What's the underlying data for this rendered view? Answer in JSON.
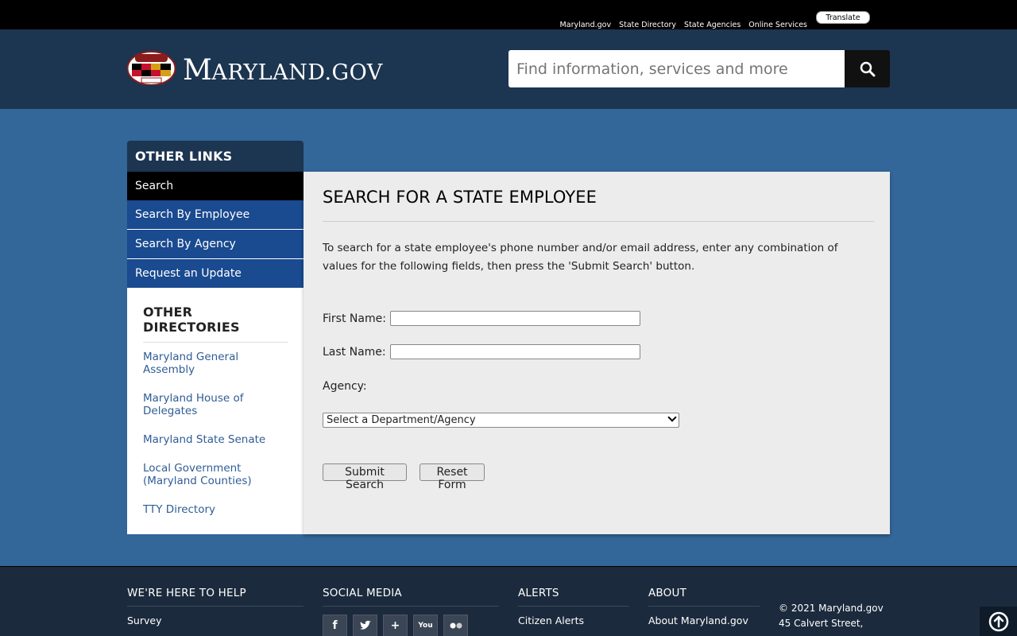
{
  "topbar": {
    "links": [
      "Maryland.gov",
      "State Directory",
      "State Agencies",
      "Online Services"
    ],
    "translate_label": "Translate"
  },
  "header": {
    "logo_big": "M",
    "logo_rest": "ARYLAND",
    "logo_suffix": ".GOV",
    "search_placeholder": "Find information, services and more"
  },
  "sidebar": {
    "heading": "OTHER LINKS",
    "items": [
      {
        "label": "Search",
        "active": true
      },
      {
        "label": "Search By Employee"
      },
      {
        "label": "Search By Agency"
      },
      {
        "label": "Request an Update"
      }
    ],
    "directories_heading": "OTHER DIRECTORIES",
    "directories": [
      "Maryland General Assembly",
      "Maryland House of Delegates",
      "Maryland State Senate",
      "Local Government (Maryland Counties)",
      "TTY Directory"
    ]
  },
  "main": {
    "title": "SEARCH FOR A STATE EMPLOYEE",
    "intro": "To search for a state employee's phone number and/or email address, enter any combination of values for the following fields, then press the 'Submit Search' button.",
    "first_name_label": "First Name:",
    "first_name_value": "",
    "last_name_label": "Last Name:",
    "last_name_value": "",
    "agency_label": "Agency:",
    "agency_selected": "Select a Department/Agency",
    "submit_label": "Submit Search",
    "reset_label": "Reset Form"
  },
  "footer": {
    "help_heading": "WE'RE HERE TO HELP",
    "help_link": "Survey",
    "social_heading": "SOCIAL MEDIA",
    "social_icons": [
      "facebook-icon",
      "twitter-icon",
      "google-plus-icon",
      "youtube-icon",
      "flickr-icon"
    ],
    "alerts_heading": "ALERTS",
    "alerts_link": "Citizen Alerts",
    "about_heading": "ABOUT",
    "about_link": "About Maryland.gov",
    "copyright": "© 2021 Maryland.gov",
    "address": "45 Calvert Street,"
  },
  "colors": {
    "page_bg": "#336699",
    "header_bg": "#1c3550",
    "nav_item_bg": "#1a4a8f",
    "footer_bg": "#1b2a3c",
    "link_color": "#2f5c96"
  }
}
